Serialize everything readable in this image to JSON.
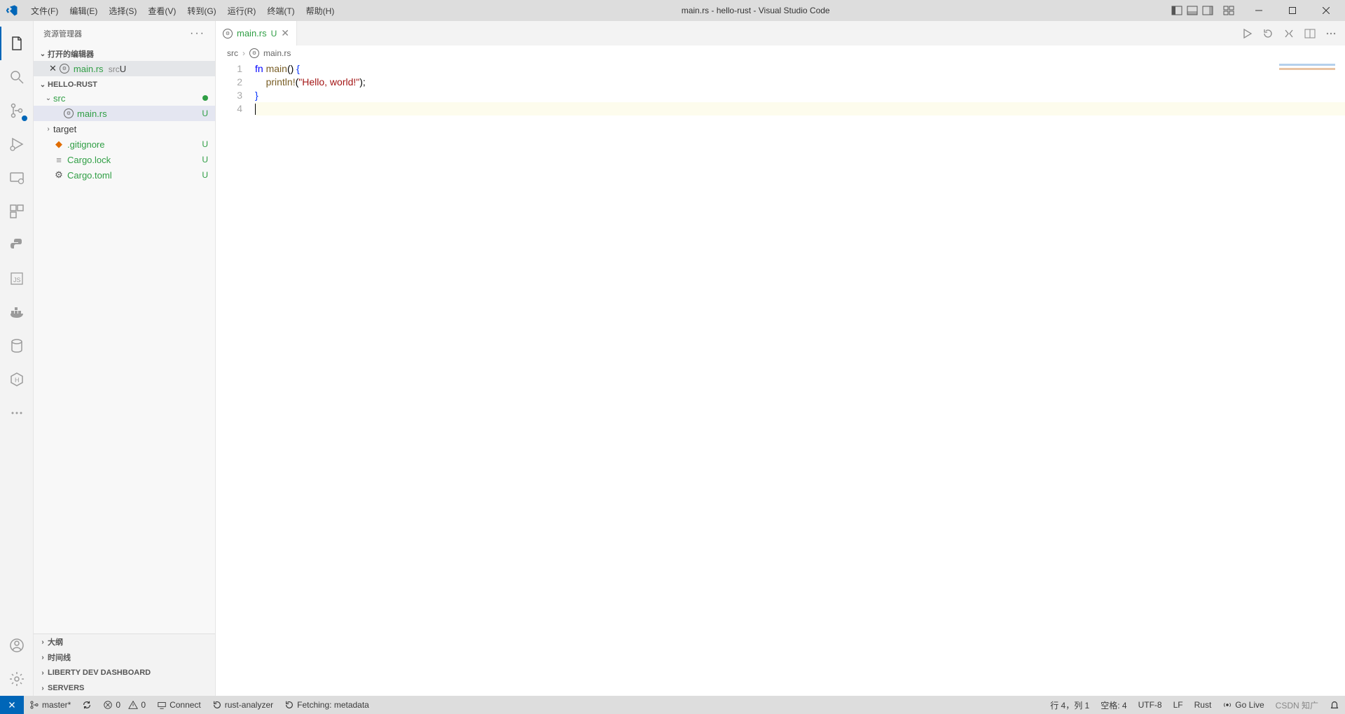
{
  "titlebar": {
    "menus": [
      "文件(F)",
      "编辑(E)",
      "选择(S)",
      "查看(V)",
      "转到(G)",
      "运行(R)",
      "终端(T)",
      "帮助(H)"
    ],
    "title": "main.rs - hello-rust - Visual Studio Code"
  },
  "sidebar": {
    "title": "资源管理器",
    "open_editors_label": "打开的编辑器",
    "open_editors": [
      {
        "name": "main.rs",
        "path": "src",
        "status": "U"
      }
    ],
    "project": "HELLO-RUST",
    "tree": [
      {
        "type": "folder",
        "name": "src",
        "expanded": true,
        "status": "dot",
        "depth": 0
      },
      {
        "type": "file",
        "name": "main.rs",
        "status": "U",
        "depth": 1,
        "selected": true,
        "icon": "rust"
      },
      {
        "type": "folder",
        "name": "target",
        "expanded": false,
        "depth": 0
      },
      {
        "type": "file",
        "name": ".gitignore",
        "status": "U",
        "depth": 0,
        "icon": "git"
      },
      {
        "type": "file",
        "name": "Cargo.lock",
        "status": "U",
        "depth": 0,
        "icon": "lock"
      },
      {
        "type": "file",
        "name": "Cargo.toml",
        "status": "U",
        "depth": 0,
        "icon": "gear"
      }
    ],
    "panels": [
      "大纲",
      "时间线",
      "LIBERTY DEV DASHBOARD",
      "SERVERS"
    ]
  },
  "tabs": {
    "items": [
      {
        "name": "main.rs",
        "status": "U"
      }
    ]
  },
  "breadcrumb": {
    "parts": [
      "src",
      "main.rs"
    ]
  },
  "code": {
    "lines": [
      {
        "n": 1,
        "segments": [
          {
            "t": "fn ",
            "c": "kw"
          },
          {
            "t": "main",
            "c": "fn"
          },
          {
            "t": "() ",
            "c": "punct"
          },
          {
            "t": "{",
            "c": "brace"
          }
        ]
      },
      {
        "n": 2,
        "segments": [
          {
            "t": "    ",
            "c": ""
          },
          {
            "t": "println!",
            "c": "fn"
          },
          {
            "t": "(",
            "c": "punct"
          },
          {
            "t": "\"Hello, world!\"",
            "c": "str"
          },
          {
            "t": ");",
            "c": "punct"
          }
        ]
      },
      {
        "n": 3,
        "segments": [
          {
            "t": "}",
            "c": "brace"
          }
        ]
      },
      {
        "n": 4,
        "segments": [],
        "current": true,
        "cursor": true
      }
    ]
  },
  "statusbar": {
    "branch": "master*",
    "errors": "0",
    "warnings": "0",
    "connect": "Connect",
    "rust_analyzer": "rust-analyzer",
    "fetching": "Fetching: metadata",
    "lncol": "行 4，列 1",
    "spaces": "空格: 4",
    "encoding": "UTF-8",
    "eol": "LF",
    "lang": "Rust",
    "golive": "Go Live",
    "watermark": "CSDN 知广"
  }
}
